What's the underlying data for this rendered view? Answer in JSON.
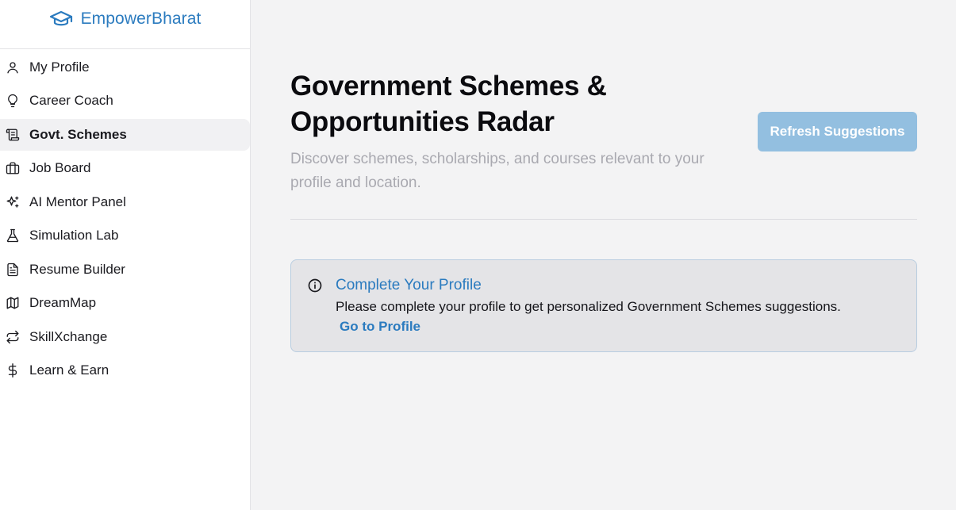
{
  "brand": {
    "name": "EmpowerBharat",
    "icon": "graduation-cap-icon",
    "color": "#2b7bbf"
  },
  "sidebar": {
    "items": [
      {
        "label": "My Profile",
        "icon": "user-icon"
      },
      {
        "label": "Career Coach",
        "icon": "lightbulb-icon"
      },
      {
        "label": "Govt. Schemes",
        "icon": "scroll-icon",
        "active": true
      },
      {
        "label": "Job Board",
        "icon": "briefcase-icon"
      },
      {
        "label": "AI Mentor Panel",
        "icon": "sparkles-icon"
      },
      {
        "label": "Simulation Lab",
        "icon": "flask-icon"
      },
      {
        "label": "Resume Builder",
        "icon": "document-icon"
      },
      {
        "label": "DreamMap",
        "icon": "map-icon"
      },
      {
        "label": "SkillXchange",
        "icon": "exchange-arrows-icon"
      },
      {
        "label": "Learn & Earn",
        "icon": "dollar-icon"
      }
    ]
  },
  "main": {
    "title": "Government Schemes & Opportunities Radar",
    "subtitle": "Discover schemes, scholarships, and courses relevant to your profile and location.",
    "refresh_label": "Refresh Suggestions",
    "alert": {
      "icon": "info-icon",
      "title": "Complete Your Profile",
      "text": "Please complete your profile to get personalized Government Schemes suggestions.",
      "link": "Go to Profile"
    }
  }
}
